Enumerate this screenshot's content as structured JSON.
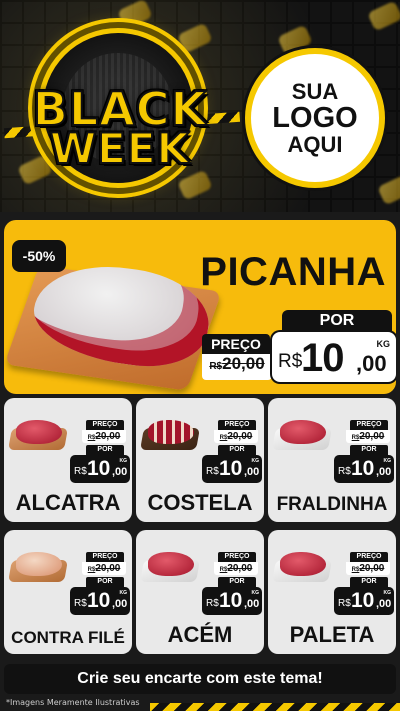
{
  "header": {
    "campaign_line1": "BLACK",
    "campaign_line2": "WEEK",
    "logo_line1": "SUA",
    "logo_line2": "LOGO",
    "logo_line3": "AQUI"
  },
  "featured": {
    "discount": "-50%",
    "name": "PICANHA",
    "label_old": "PREÇO",
    "label_new": "POR",
    "old_currency": "R$",
    "old_price": "20,00",
    "currency": "R$",
    "price_int": "10",
    "price_dec": ",00",
    "unit": "KG"
  },
  "products": [
    {
      "name": "ALCATRA",
      "label_old": "PREÇO",
      "old_currency": "R$",
      "old_price": "20,00",
      "label_new": "POR",
      "currency": "R$",
      "price_int": "10",
      "price_dec": ",00",
      "unit": "KG"
    },
    {
      "name": "COSTELA",
      "label_old": "PREÇO",
      "old_currency": "R$",
      "old_price": "20,00",
      "label_new": "POR",
      "currency": "R$",
      "price_int": "10",
      "price_dec": ",00",
      "unit": "KG"
    },
    {
      "name": "FRALDINHA",
      "label_old": "PREÇO",
      "old_currency": "R$",
      "old_price": "20,00",
      "label_new": "POR",
      "currency": "R$",
      "price_int": "10",
      "price_dec": ",00",
      "unit": "KG"
    },
    {
      "name": "CONTRA FILÉ",
      "label_old": "PREÇO",
      "old_currency": "R$",
      "old_price": "20,00",
      "label_new": "POR",
      "currency": "R$",
      "price_int": "10",
      "price_dec": ",00",
      "unit": "KG"
    },
    {
      "name": "ACÉM",
      "label_old": "PREÇO",
      "old_currency": "R$",
      "old_price": "20,00",
      "label_new": "POR",
      "currency": "R$",
      "price_int": "10",
      "price_dec": ",00",
      "unit": "KG"
    },
    {
      "name": "PALETA",
      "label_old": "PREÇO",
      "old_currency": "R$",
      "old_price": "20,00",
      "label_new": "POR",
      "currency": "R$",
      "price_int": "10",
      "price_dec": ",00",
      "unit": "KG"
    }
  ],
  "footer": {
    "cta": "Crie seu encarte com este tema!",
    "disclaimer": "*Imagens Meramente Ilustrativas"
  },
  "colors": {
    "brand_yellow": "#f7bb0c",
    "dark": "#111111",
    "card_bg": "#e9e9e9"
  }
}
